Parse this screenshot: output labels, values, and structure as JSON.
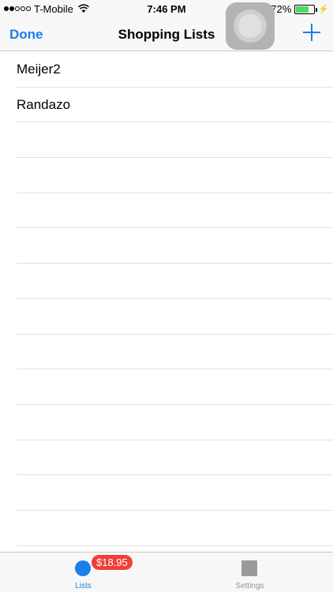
{
  "status_bar": {
    "carrier": "T-Mobile",
    "time": "7:46 PM",
    "battery_percent": "72%",
    "battery_level": 0.72,
    "signal_bars_filled": 2,
    "signal_bars_total": 5
  },
  "nav": {
    "left_button": "Done",
    "title": "Shopping Lists",
    "right_button_icon": "plus-icon"
  },
  "lists": [
    {
      "name": "Meijer2"
    },
    {
      "name": "Randazo"
    }
  ],
  "empty_row_count": 12,
  "tabs": [
    {
      "label": "Lists",
      "icon": "circle-icon",
      "badge": "$18.95",
      "selected": true
    },
    {
      "label": "Settings",
      "icon": "square-icon",
      "selected": false
    }
  ],
  "colors": {
    "accent": "#1a7fe8",
    "badge": "#f03f3a",
    "battery": "#4cd964"
  }
}
